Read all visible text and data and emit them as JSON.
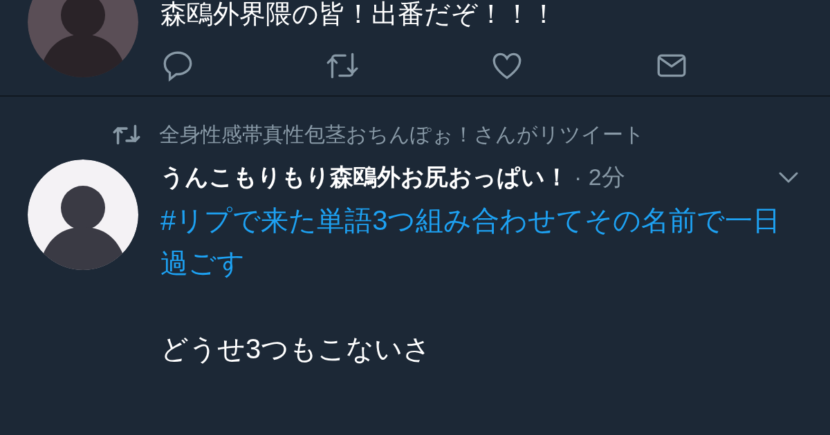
{
  "tweets": [
    {
      "kind": "tweet",
      "text": "森鴎外界隈の皆！出番だぞ！！！",
      "actions": [
        {
          "kind": "reply"
        },
        {
          "kind": "retweet"
        },
        {
          "kind": "like"
        },
        {
          "kind": "message"
        }
      ]
    },
    {
      "kind": "retweet",
      "retweeted_by": "全身性感帯真性包茎おちんぽぉ！さんがリツイート",
      "name": "うんこもりもり森鴎外お尻おっぱい！",
      "time": "· 2分",
      "body": [
        {
          "kind": "hashtag",
          "text": "#リプで来た単語3つ組み合わせてその名前で一日過ごす"
        },
        {
          "kind": "text",
          "text": "どうせ3つもこないさ"
        }
      ]
    }
  ]
}
